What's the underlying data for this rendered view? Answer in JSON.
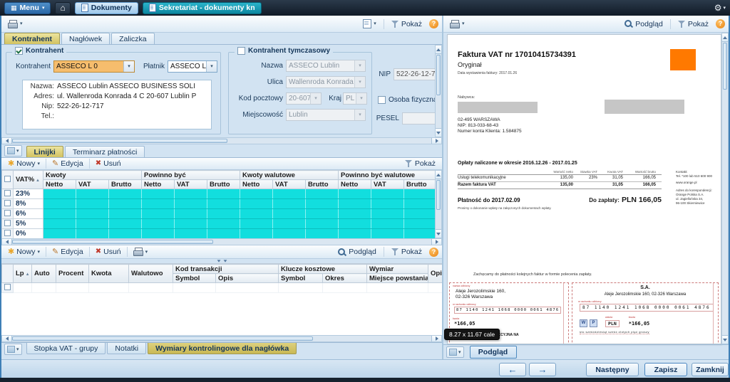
{
  "icons": {
    "caret": "▾",
    "home": "⌂",
    "gear": "⚙",
    "menu_grid": "▦",
    "help": "?",
    "new": "✱",
    "edit": "✎",
    "delete": "✖",
    "arrow_left": "←",
    "arrow_right": "→"
  },
  "colors": {
    "accent_teal": "#0c86a0",
    "highlight_orange": "#f6bd6d",
    "grid_cyan": "#12dede",
    "brand_orange": "#ff7900",
    "slip_red": "#bf3a3a"
  },
  "topbar": {
    "menu": "Menu",
    "dokumenty": "Dokumenty",
    "active_tab": "Sekretariat - dokumenty kn"
  },
  "left_toolbar": {
    "pokaz": "Pokaż"
  },
  "tabs": {
    "kontrahent": "Kontrahent",
    "naglowek": "Nagłówek",
    "zaliczka": "Zaliczka"
  },
  "kontrahent": {
    "group_title": "Kontrahent",
    "kontrahent_label": "Kontrahent",
    "kontrahent_value": "ASSECO L 0",
    "platnik_label": "Płatnik",
    "platnik_value": "ASSECO L 0",
    "info": {
      "nazwa_label": "Nazwa:",
      "nazwa": "ASSECO Lublin ASSECO BUSINESS SOLI",
      "adres_label": "Adres:",
      "adres": "ul. Wallenroda Konrada 4 C 20-607 Lublin P",
      "nip_label": "Nip:",
      "nip": "522-26-12-717",
      "tel_label": "Tel.:"
    }
  },
  "tymczasowy": {
    "group_title": "Kontrahent tymczasowy",
    "nazwa_label": "Nazwa",
    "nazwa": "ASSECO Lublin",
    "ulica_label": "Ulica",
    "ulica": "Wallenroda Konrada",
    "kod_label": "Kod pocztowy",
    "kod": "20-607",
    "kraj_label": "Kraj",
    "kraj": "PL",
    "miejscowosc_label": "Miejscowość",
    "miejscowosc": "Lublin"
  },
  "extra_fields": {
    "nip_label": "NIP",
    "nip": "522-26-12-717",
    "osoba_fizyczna": "Osoba fizyczna",
    "pesel_label": "PESEL"
  },
  "linijki": {
    "tab_linijki": "Linijki",
    "tab_terminarz": "Terminarz płatności",
    "nowy": "Nowy",
    "edycja": "Edycja",
    "usun": "Usuń",
    "pokaz": "Pokaż",
    "col_vat": "VAT%",
    "group_kwoty": "Kwoty",
    "group_powinno": "Powinno być",
    "group_kwoty_wal": "Kwoty walutowe",
    "group_powinno_wal": "Powinno być walutowe",
    "sub_netto": "Netto",
    "sub_vat": "VAT",
    "sub_brutto": "Brutto",
    "rows": [
      "23%",
      "8%",
      "6%",
      "5%",
      "0%"
    ]
  },
  "stopka": {
    "nowy": "Nowy",
    "edycja": "Edycja",
    "usun": "Usuń",
    "podglad": "Podgląd",
    "pokaz": "Pokaż",
    "col_lp": "Lp",
    "col_auto": "Auto",
    "col_procent": "Procent",
    "col_kwota": "Kwota",
    "col_walutowo": "Walutowo",
    "col_kod": "Kod transakcji",
    "col_klucze": "Klucze kosztowe",
    "col_wymiar": "Wymiar",
    "col_opis": "Opis",
    "sub_symbol": "Symbol",
    "sub_opis": "Opis",
    "sub_okres": "Okres",
    "sub_miejsce": "Miejsce powstania kosztu/przychodu"
  },
  "bottom_tabs": {
    "stopka_vat": "Stopka VAT - grupy",
    "notatki": "Notatki",
    "wymiary": "Wymiary kontrolingowe dla nagłówka"
  },
  "preview": {
    "podglad": "Podgląd",
    "pokaz": "Pokaż",
    "podglad_button": "Podgląd",
    "tooltip": "8.27 x 11.67 cale"
  },
  "invoice": {
    "title": "Faktura VAT nr 17010415734391",
    "original": "Oryginał",
    "issue_date": "Data wystawienia faktury: 2017.01.26",
    "nabywca": "Nabywca:",
    "addr_city": "02-495 WARSZAWA",
    "nip": "NIP: 813-033-68-43",
    "client_no": "Numer konta Klienta: 1.584875",
    "charges_title": "Opłaty naliczone w okresie 2016.12.26 - 2017.01.25",
    "th_netto": "Wartość netto",
    "th_stawka": "Stawka VAT",
    "th_kwota": "Kwota VAT",
    "th_brutto": "Wartość brutto",
    "row1_name": "Usługi telekomunikacyjne",
    "row1_netto": "135,00",
    "row1_stawka": "23%",
    "row1_vat": "31,05",
    "row1_brutto": "166,05",
    "row2_name": "Razem faktura VAT",
    "row2_netto": "135,00",
    "row2_vat": "31,05",
    "row2_brutto": "166,05",
    "kontakt1": "Kontakt:",
    "kontakt2": "Tel. *100 lub 510 600 900",
    "www": "www.orange.pl",
    "kor1": "Adres do korespondencji:",
    "kor2": "Orange Polska S.A.",
    "kor3": "ul. Jagiellońska 34,",
    "kor4": "96-100 Skierniewice",
    "payment_due": "Płatność do 2017.02.09",
    "payment_note": "Prosimy o dokonanie wpłaty na załączonych dokumentach wpłaty.",
    "to_pay_label": "Do zapłaty:",
    "to_pay_value": "PLN 166,05",
    "encourage": "Zachęcamy do płatności kolejnych faktur w formie polecenia zapłaty.",
    "slip_left": {
      "label_name": "nazwa odbiorcy",
      "addr1": "Aleje Jerozolimskie 160,",
      "addr2": "02-326 Warszawa",
      "label_account": "nr rachunku odbiorcy",
      "account": "87 1140 1241 1068 0000 0061 4876",
      "kwota_label": "kwota",
      "amount": "*166,05",
      "fragment": "AKCYJNA NA"
    },
    "slip_right": {
      "name": "S.A.",
      "addr": "Aleje Jerozolimskie 160, 02-326 Warszawa",
      "label_account": "nr rachunku odbiorcy",
      "account": "87 1140 1241 1068 0000 0061 4876",
      "w": "W",
      "p": "P",
      "waluta_label": "waluta",
      "waluta": "PLN",
      "kwota_label": "kwota",
      "amount": "*166,05",
      "words": "sto sześćdziesiąt sześć złotych pięć groszy"
    }
  },
  "footer": {
    "nastepny": "Następny",
    "zapisz": "Zapisz",
    "zamknij": "Zamknij"
  }
}
